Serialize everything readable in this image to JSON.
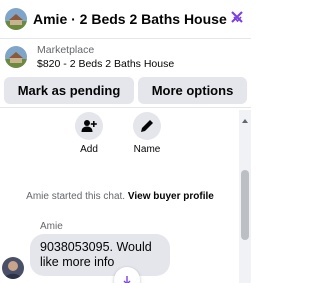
{
  "header": {
    "title": "Amie · 2 Beds 2 Baths House",
    "accent_color": "#7b3fe4",
    "icons": [
      "house-thumbnail-icon",
      "chevron-down-icon",
      "close-icon"
    ]
  },
  "marketplace": {
    "label": "Marketplace",
    "listing": "$820 - 2 Beds 2 Baths House"
  },
  "actions": {
    "mark_pending": "Mark as pending",
    "more_options": "More options"
  },
  "chat": {
    "contact_actions": [
      {
        "label": "Add",
        "icon": "add-person-icon"
      },
      {
        "label": "Name",
        "icon": "pencil-icon"
      }
    ],
    "system_message": "Amie started this chat.",
    "system_link": "View buyer profile",
    "messages": [
      {
        "sender": "Amie",
        "text": "9038053095. Would like more info"
      }
    ]
  }
}
